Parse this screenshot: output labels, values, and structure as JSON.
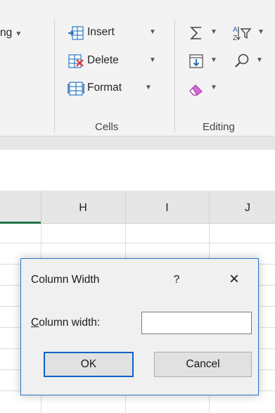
{
  "ribbon": {
    "partial_left_label": "ng",
    "cells": {
      "insert_label": "Insert",
      "delete_label": "Delete",
      "format_label": "Format",
      "group_label": "Cells"
    },
    "editing": {
      "group_label": "Editing",
      "icons": [
        "autosum-icon",
        "sort-filter-icon",
        "fill-icon",
        "find-select-icon",
        "clear-eraser-icon"
      ]
    }
  },
  "columns": [
    "H",
    "I",
    "J"
  ],
  "dialog": {
    "title": "Column Width",
    "help_label": "?",
    "close_label": "×",
    "field_label_first": "C",
    "field_label_rest": "olumn width:",
    "field_value": "",
    "ok_label": "OK",
    "cancel_label": "Cancel"
  },
  "colors": {
    "accent": "#2f74c5",
    "selection_green": "#217346",
    "eraser_pink": "#c94fc9"
  }
}
